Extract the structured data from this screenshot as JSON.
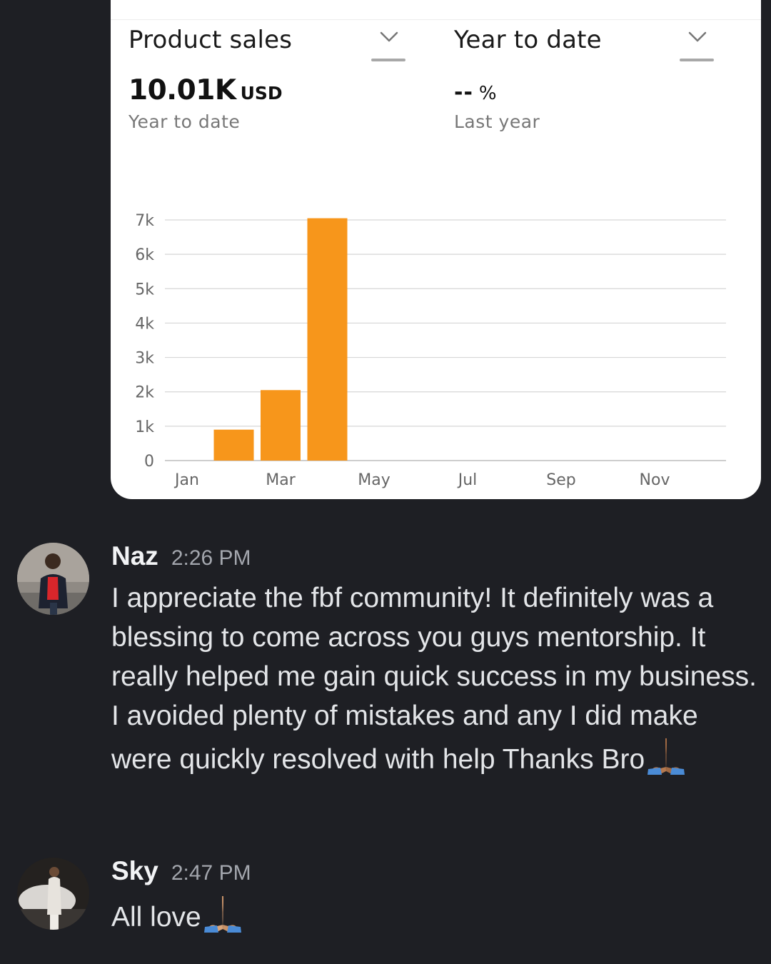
{
  "card": {
    "metric_selector": "Product sales",
    "period_selector": "Year to date",
    "sales_value": "10.01K",
    "sales_unit": "USD",
    "sales_caption": "Year to date",
    "change_value": "--",
    "change_unit": "%",
    "change_caption": "Last year"
  },
  "chart_data": {
    "type": "bar",
    "categories": [
      "Jan",
      "Feb",
      "Mar",
      "Apr",
      "May",
      "Jun",
      "Jul",
      "Aug",
      "Sep",
      "Oct",
      "Nov",
      "Dec"
    ],
    "values": [
      0,
      900,
      2050,
      7050,
      0,
      0,
      0,
      0,
      0,
      0,
      0,
      0
    ],
    "x_tick_labels": [
      "Jan",
      "Mar",
      "May",
      "Jul",
      "Sep",
      "Nov"
    ],
    "y_tick_labels": [
      "0",
      "1k",
      "2k",
      "3k",
      "4k",
      "5k",
      "6k",
      "7k"
    ],
    "ylim": [
      0,
      7000
    ],
    "grid": true,
    "bar_color": "#f7961b",
    "title": "",
    "xlabel": "",
    "ylabel": ""
  },
  "messages": [
    {
      "author": "Naz",
      "time": "2:26 PM",
      "text": "I appreciate the fbf community! It definitely was a blessing to come across you guys mentorship. It really helped me gain quick success in my business. I avoided plenty of mistakes and any I did make were quickly resolved with help Thanks Bro",
      "emoji": "folded-hands-emoji"
    },
    {
      "author": "Sky",
      "time": "2:47 PM",
      "text": "All love",
      "emoji": "folded-hands-emoji"
    }
  ],
  "colors": {
    "background": "#1e1f24",
    "card": "#ffffff",
    "accent_bar": "#f7961b"
  }
}
